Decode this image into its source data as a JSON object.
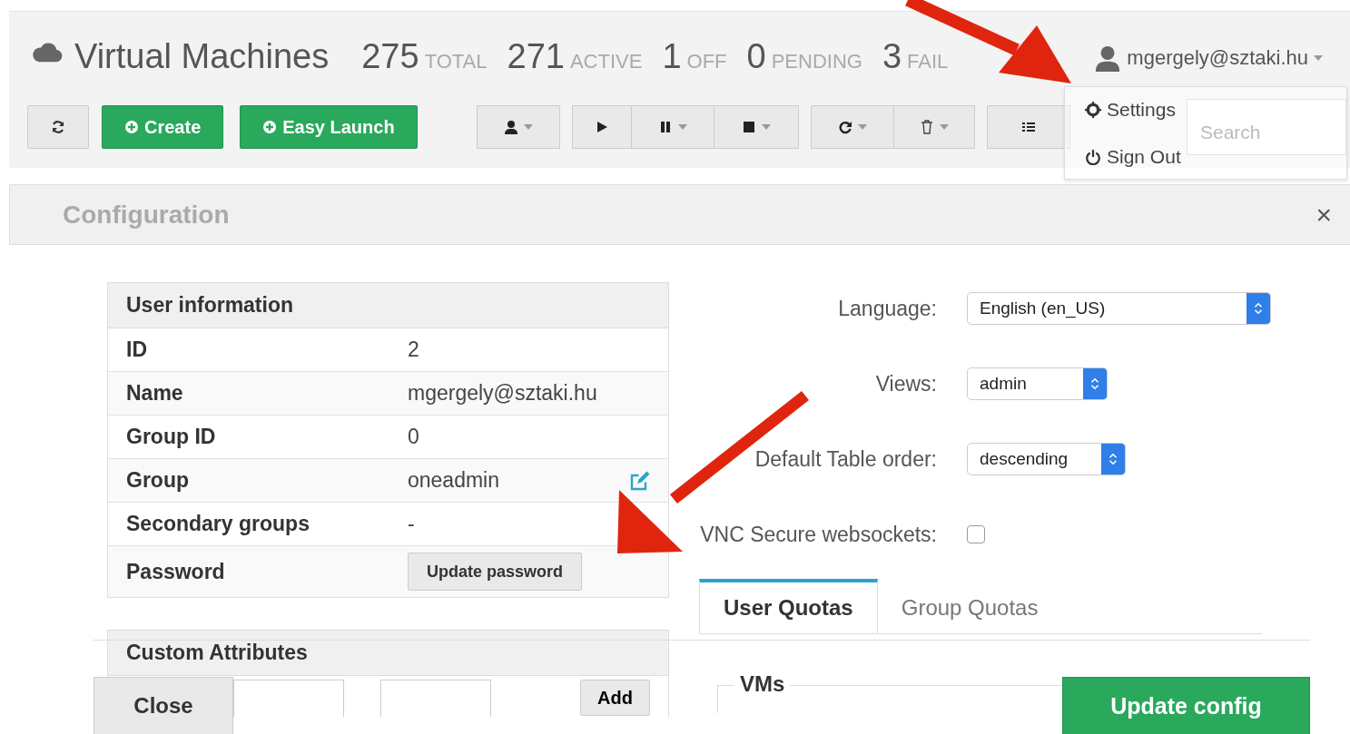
{
  "header": {
    "title": "Virtual Machines",
    "stats": [
      {
        "count": "275",
        "label": "TOTAL"
      },
      {
        "count": "271",
        "label": "ACTIVE"
      },
      {
        "count": "1",
        "label": "OFF"
      },
      {
        "count": "0",
        "label": "PENDING"
      },
      {
        "count": "3",
        "label": "FAIL"
      }
    ],
    "user": "mgergely@sztaki.hu"
  },
  "toolbar": {
    "create": "Create",
    "easy_launch": "Easy Launch",
    "search_placeholder": "Search"
  },
  "user_menu": {
    "items": [
      {
        "kind": "settings",
        "label": "Settings"
      },
      {
        "kind": "power",
        "label": "Sign Out"
      }
    ]
  },
  "panel": {
    "title": "Configuration",
    "close": "×"
  },
  "user_info": {
    "title": "User information",
    "rows": [
      {
        "label": "ID",
        "value": "2"
      },
      {
        "label": "Name",
        "value": "mgergely@sztaki.hu"
      },
      {
        "label": "Group ID",
        "value": "0"
      },
      {
        "label": "Group",
        "value": "oneadmin",
        "editable": true
      },
      {
        "label": "Secondary groups",
        "value": "-"
      },
      {
        "label": "Password",
        "button": "Update password"
      }
    ]
  },
  "custom_attributes": {
    "title": "Custom Attributes",
    "add_button": "Add"
  },
  "settings": [
    {
      "kind": "select",
      "label": "Language:",
      "value": "English (en_US)"
    },
    {
      "kind": "select",
      "label": "Views:",
      "value": "admin"
    },
    {
      "kind": "select",
      "label": "Default Table order:",
      "value": "descending"
    },
    {
      "kind": "checkbox",
      "label": "VNC Secure websockets:",
      "checked": false
    }
  ],
  "quota_tabs": [
    {
      "label": "User Quotas",
      "selected": true
    },
    {
      "label": "Group Quotas",
      "selected": false
    }
  ],
  "quota_sections": [
    {
      "title": "VMs"
    }
  ],
  "footer": {
    "close": "Close",
    "update": "Update config"
  }
}
